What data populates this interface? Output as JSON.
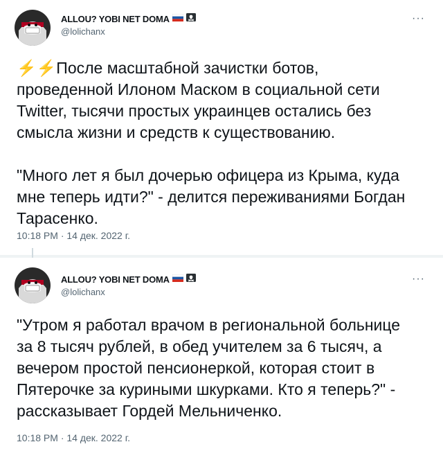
{
  "tweets": [
    {
      "display_name": "ALLOU? YOBI NET DOMA",
      "handle": "@lolichanx",
      "emoji": "⚡⚡",
      "text": "После масштабной зачистки ботов,\nпроведенной Илоном Маском в социальной сети\nTwitter, тысячи простых украинцев остались без\nсмысла жизни и средств к существованию.\n\n\"Много лет я был дочерью офицера из Крыма, куда\nмне теперь идти?\" - делится переживаниями Богдан\nТарасенко.",
      "timestamp": "10:18 PM · 14 дек. 2022 г.",
      "more_label": "···"
    },
    {
      "display_name": "ALLOU? YOBI NET DOMA",
      "handle": "@lolichanx",
      "text": "\"Утром я работал врачом в региональной больнице\nза 8 тысяч рублей, в обед учителем за 6 тысяч, а\nвечером простой пенсионеркой, которая стоит в\nПятерочке за куриными шкурками. Кто я теперь?\" -\nрассказывает Гордей Мельниченко.",
      "timestamp": "10:18 PM · 14 дек. 2022 г.",
      "more_label": "···"
    }
  ],
  "icons": {
    "avatar": "avatar-icon",
    "flag": "russian-flag-icon",
    "pirate": "pirate-flag-icon",
    "more": "more-options-icon"
  },
  "colors": {
    "text": "#0f1419",
    "secondary": "#536471",
    "lightning": "#ffac33",
    "divider": "#eff3f4"
  }
}
